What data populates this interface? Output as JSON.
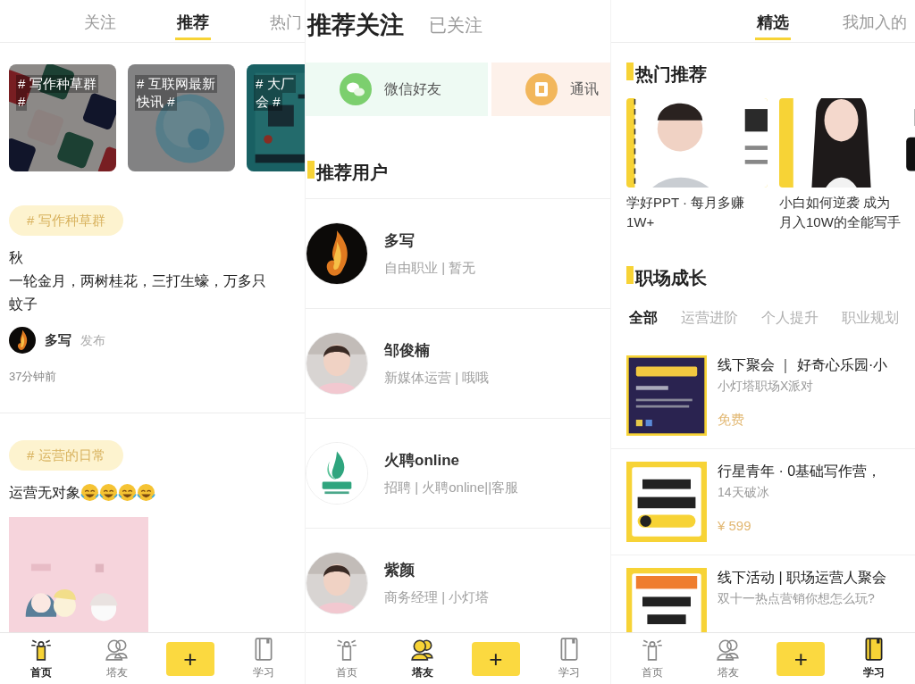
{
  "panels": [
    {
      "kind": "feed",
      "tabs": [
        {
          "label": "关注",
          "selected": false
        },
        {
          "label": "推荐",
          "selected": true
        },
        {
          "label": "热门",
          "selected": false
        }
      ],
      "topics": [
        {
          "title_lines": [
            "# 写作种草群",
            "#"
          ]
        },
        {
          "title_lines": [
            "# 互联网最新",
            "快讯 #"
          ]
        },
        {
          "title_lines": [
            "# 大厂",
            "会 #"
          ]
        }
      ],
      "posts": [
        {
          "tag": "# 写作种草群",
          "lines": [
            "秋",
            "一轮金月，两树桂花，三打生蠔，万多只",
            "蚊子"
          ],
          "author": "多写",
          "action": "发布",
          "time": "37分钟前",
          "laughing_emojis": false,
          "has_picture": false
        },
        {
          "tag": "# 运营的日常",
          "lines": [
            "运营无对象"
          ],
          "laughing_emojis": true,
          "has_picture": true
        }
      ],
      "nav": [
        {
          "kind": "home",
          "label": "首页",
          "selected": true
        },
        {
          "kind": "friends",
          "label": "塔友",
          "selected": false
        },
        {
          "kind": "add",
          "label": "+",
          "selected": false
        },
        {
          "kind": "study",
          "label": "学习",
          "selected": false
        }
      ]
    },
    {
      "kind": "follow",
      "tabs": [
        {
          "label": "推荐关注",
          "selected": true
        },
        {
          "label": "已关注",
          "selected": false
        }
      ],
      "invite_cards": [
        {
          "kind": "wechat",
          "label": "微信好友"
        },
        {
          "kind": "contacts",
          "label": "通讯"
        }
      ],
      "section_title": "推荐用户",
      "users": [
        {
          "name": "多写",
          "info": "自由职业 | 暂无"
        },
        {
          "name": "邹俊楠",
          "info": "新媒体运营 | 哦哦"
        },
        {
          "name": "火聘online",
          "info": "招聘 | 火聘online||客服"
        },
        {
          "name": "紫颜",
          "info": "商务经理 | 小灯塔"
        }
      ],
      "nav": [
        {
          "kind": "home",
          "label": "首页",
          "selected": false
        },
        {
          "kind": "friends",
          "label": "塔友",
          "selected": true
        },
        {
          "kind": "add",
          "label": "+",
          "selected": false
        },
        {
          "kind": "study",
          "label": "学习",
          "selected": false
        }
      ]
    },
    {
      "kind": "courses",
      "tabs": [
        {
          "label": "精选",
          "selected": true
        },
        {
          "label": "我加入的",
          "selected": false
        }
      ],
      "hot_title": "热门推荐",
      "featured": [
        {
          "title_lines": [
            "学好PPT · 每月多赚",
            "1W+"
          ]
        },
        {
          "title_lines": [
            "小白如何逆袭 成为",
            "月入10W的全能写手"
          ]
        }
      ],
      "growth_title": "职场成长",
      "filters": [
        {
          "label": "全部",
          "selected": true
        },
        {
          "label": "运营进阶",
          "selected": false
        },
        {
          "label": "个人提升",
          "selected": false
        },
        {
          "label": "职业规划",
          "selected": false
        }
      ],
      "items": [
        {
          "title": "线下聚会 ｜ 好奇心乐园·小",
          "subtitle": "小灯塔职场X派对",
          "price": "免费"
        },
        {
          "title": "行星青年 · 0基础写作营，",
          "subtitle": "14天破冰",
          "price": "¥ 599"
        },
        {
          "title": "线下活动 | 职场运营人聚会",
          "subtitle": "双十一热点营销你想怎么玩?"
        }
      ],
      "nav": [
        {
          "kind": "home",
          "label": "首页",
          "selected": false
        },
        {
          "kind": "friends",
          "label": "塔友",
          "selected": false
        },
        {
          "kind": "add",
          "label": "+",
          "selected": false
        },
        {
          "kind": "study",
          "label": "学习",
          "selected": true
        }
      ]
    }
  ]
}
